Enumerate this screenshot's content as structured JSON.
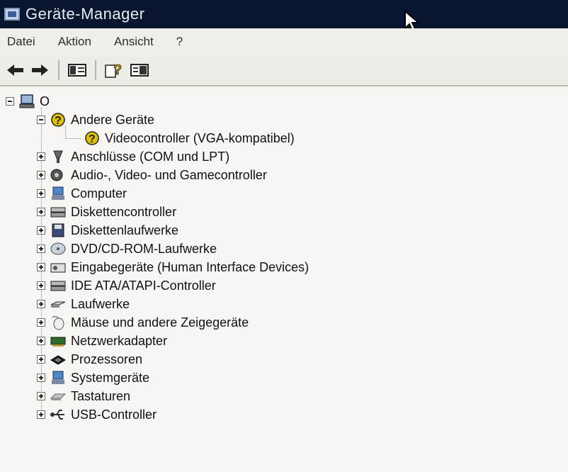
{
  "window": {
    "title": "Geräte-Manager"
  },
  "menu": [
    {
      "label": "Datei"
    },
    {
      "label": "Aktion"
    },
    {
      "label": "Ansicht"
    },
    {
      "label": "?"
    }
  ],
  "toolbar": {
    "buttons": [
      {
        "name": "back-button",
        "icon": "arrow-left-icon"
      },
      {
        "name": "forward-button",
        "icon": "arrow-right-icon"
      },
      {
        "name": "show-hide-console-tree-button",
        "icon": "console-tree-icon"
      },
      {
        "name": "help-button",
        "icon": "help-icon"
      },
      {
        "name": "properties-button",
        "icon": "properties-icon"
      }
    ]
  },
  "tree": {
    "root": {
      "label": "O",
      "expanded": true,
      "icon": "computer-icon"
    },
    "items": [
      {
        "label": "Andere Geräte",
        "expanded": true,
        "icon": "unknown-device-icon",
        "children": [
          {
            "label": "Videocontroller (VGA-kompatibel)",
            "icon": "unknown-device-icon"
          }
        ]
      },
      {
        "label": "Anschlüsse (COM und LPT)",
        "expanded": false,
        "icon": "port-icon"
      },
      {
        "label": "Audio-, Video- und Gamecontroller",
        "expanded": false,
        "icon": "audio-icon"
      },
      {
        "label": "Computer",
        "expanded": false,
        "icon": "computer-icon"
      },
      {
        "label": "Diskettencontroller",
        "expanded": false,
        "icon": "controller-icon"
      },
      {
        "label": "Diskettenlaufwerke",
        "expanded": false,
        "icon": "floppy-icon"
      },
      {
        "label": "DVD/CD-ROM-Laufwerke",
        "expanded": false,
        "icon": "cdrom-icon"
      },
      {
        "label": "Eingabegeräte (Human Interface Devices)",
        "expanded": false,
        "icon": "hid-icon"
      },
      {
        "label": "IDE ATA/ATAPI-Controller",
        "expanded": false,
        "icon": "ide-icon"
      },
      {
        "label": "Laufwerke",
        "expanded": false,
        "icon": "disk-drive-icon"
      },
      {
        "label": "Mäuse und andere Zeigegeräte",
        "expanded": false,
        "icon": "mouse-icon"
      },
      {
        "label": "Netzwerkadapter",
        "expanded": false,
        "icon": "network-icon"
      },
      {
        "label": "Prozessoren",
        "expanded": false,
        "icon": "processor-icon"
      },
      {
        "label": "Systemgeräte",
        "expanded": false,
        "icon": "system-icon"
      },
      {
        "label": "Tastaturen",
        "expanded": false,
        "icon": "keyboard-icon"
      },
      {
        "label": "USB-Controller",
        "expanded": false,
        "icon": "usb-icon"
      }
    ]
  }
}
